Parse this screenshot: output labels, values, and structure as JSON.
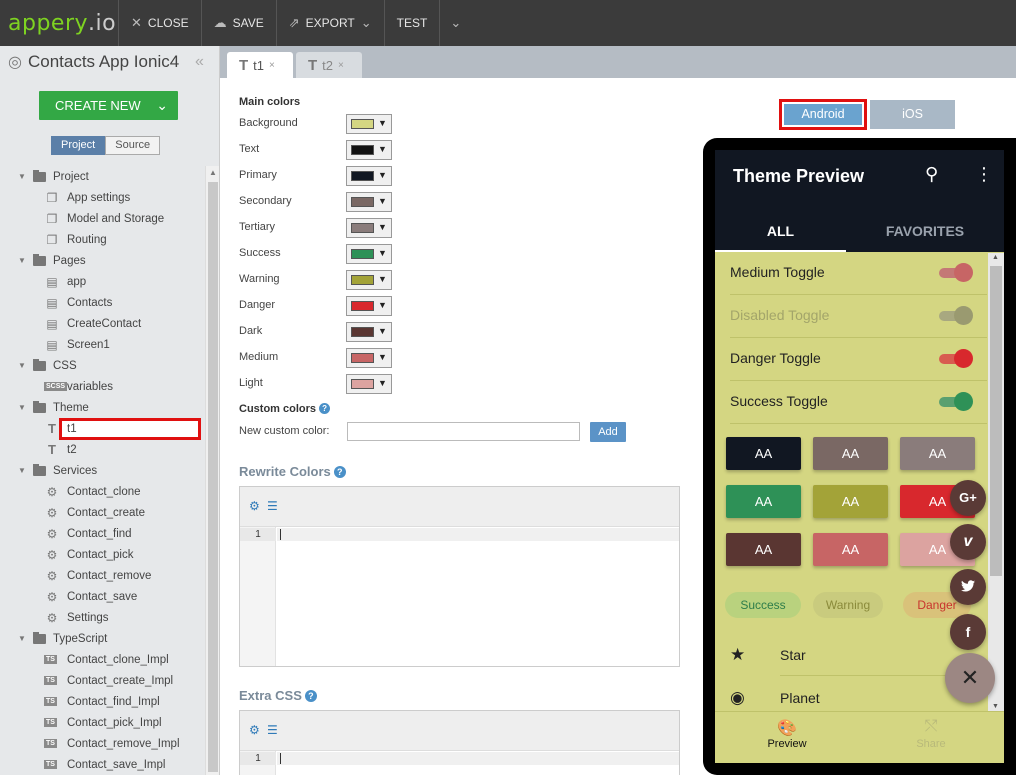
{
  "topbar": {
    "logo_main": "appery",
    "logo_dot": ".io",
    "close_label": "CLOSE",
    "save_label": "SAVE",
    "export_label": "EXPORT",
    "test_label": "TEST"
  },
  "left": {
    "project_title": "Contacts App Ionic4",
    "create_new": "CREATE NEW",
    "tab_project": "Project",
    "tab_source": "Source",
    "tree": [
      {
        "label": "Project",
        "level": 0,
        "icon": "folder"
      },
      {
        "label": "App settings",
        "level": 1,
        "icon": "doc-stack"
      },
      {
        "label": "Model and Storage",
        "level": 1,
        "icon": "doc-stack"
      },
      {
        "label": "Routing",
        "level": 1,
        "icon": "doc-stack"
      },
      {
        "label": "Pages",
        "level": 0,
        "icon": "folder"
      },
      {
        "label": "app",
        "level": 1,
        "icon": "doc"
      },
      {
        "label": "Contacts",
        "level": 1,
        "icon": "doc"
      },
      {
        "label": "CreateContact",
        "level": 1,
        "icon": "doc"
      },
      {
        "label": "Screen1",
        "level": 1,
        "icon": "doc"
      },
      {
        "label": "CSS",
        "level": 0,
        "icon": "folder"
      },
      {
        "label": "variables",
        "level": 1,
        "icon": "scss",
        "badge": "SCSS"
      },
      {
        "label": "Theme",
        "level": 0,
        "icon": "folder"
      },
      {
        "label": "t1",
        "level": 1,
        "icon": "theme"
      },
      {
        "label": "t2",
        "level": 1,
        "icon": "theme"
      },
      {
        "label": "Services",
        "level": 0,
        "icon": "folder"
      },
      {
        "label": "Contact_clone",
        "level": 1,
        "icon": "gear"
      },
      {
        "label": "Contact_create",
        "level": 1,
        "icon": "gear"
      },
      {
        "label": "Contact_find",
        "level": 1,
        "icon": "gear"
      },
      {
        "label": "Contact_pick",
        "level": 1,
        "icon": "gear"
      },
      {
        "label": "Contact_remove",
        "level": 1,
        "icon": "gear"
      },
      {
        "label": "Contact_save",
        "level": 1,
        "icon": "gear"
      },
      {
        "label": "Settings",
        "level": 1,
        "icon": "gear"
      },
      {
        "label": "TypeScript",
        "level": 0,
        "icon": "folder"
      },
      {
        "label": "Contact_clone_Impl",
        "level": 1,
        "icon": "ts",
        "badge": "TS"
      },
      {
        "label": "Contact_create_Impl",
        "level": 1,
        "icon": "ts",
        "badge": "TS"
      },
      {
        "label": "Contact_find_Impl",
        "level": 1,
        "icon": "ts",
        "badge": "TS"
      },
      {
        "label": "Contact_pick_Impl",
        "level": 1,
        "icon": "ts",
        "badge": "TS"
      },
      {
        "label": "Contact_remove_Impl",
        "level": 1,
        "icon": "ts",
        "badge": "TS"
      },
      {
        "label": "Contact_save_Impl",
        "level": 1,
        "icon": "ts",
        "badge": "TS"
      }
    ]
  },
  "tabs": [
    {
      "label": "t1",
      "glyph": "T",
      "close": "×"
    },
    {
      "label": "t2",
      "glyph": "T",
      "close": "×"
    }
  ],
  "form": {
    "main_colors_title": "Main colors",
    "colors": [
      {
        "label": "Background",
        "color": "#d4d682"
      },
      {
        "label": "Text",
        "color": "#111111"
      },
      {
        "label": "Primary",
        "color": "#111722"
      },
      {
        "label": "Secondary",
        "color": "#7a6864"
      },
      {
        "label": "Tertiary",
        "color": "#8a7c7b"
      },
      {
        "label": "Success",
        "color": "#2e9157"
      },
      {
        "label": "Warning",
        "color": "#a3a338"
      },
      {
        "label": "Danger",
        "color": "#d8282d"
      },
      {
        "label": "Dark",
        "color": "#5a3632"
      },
      {
        "label": "Medium",
        "color": "#c76565"
      },
      {
        "label": "Light",
        "color": "#dca3a0"
      }
    ],
    "custom_colors_title": "Custom colors",
    "new_custom_label": "New custom color:",
    "new_custom_value": "",
    "add_label": "Add",
    "rewrite_title": "Rewrite Colors",
    "extra_css_title": "Extra CSS",
    "line_1": "1"
  },
  "preview": {
    "android_label": "Android",
    "ios_label": "iOS",
    "app_title": "Theme Preview",
    "seg_all": "ALL",
    "seg_favorites": "FAVORITES",
    "toggles": [
      {
        "label": "Medium Toggle",
        "track": "#c47876",
        "knob": "#c76565",
        "label_color": "#222"
      },
      {
        "label": "Disabled Toggle",
        "track": "#a8a880",
        "knob": "#9a9a70",
        "label_color": "#a3a56a"
      },
      {
        "label": "Danger Toggle",
        "track": "#d85c50",
        "knob": "#d8282d",
        "label_color": "#222"
      },
      {
        "label": "Success Toggle",
        "track": "#5aa070",
        "knob": "#2e9157",
        "label_color": "#222"
      }
    ],
    "aa_buttons": [
      {
        "label": "AA",
        "color": "#111722"
      },
      {
        "label": "AA",
        "color": "#7a6864"
      },
      {
        "label": "AA",
        "color": "#8a7c7b"
      },
      {
        "label": "AA",
        "color": "#2e9157"
      },
      {
        "label": "AA",
        "color": "#a3a338"
      },
      {
        "label": "AA",
        "color": "#d8282d"
      },
      {
        "label": "AA",
        "color": "#5a3632"
      },
      {
        "label": "AA",
        "color": "#c76565"
      },
      {
        "label": "AA",
        "color": "#dca3a0"
      }
    ],
    "chips": [
      {
        "label": "Success",
        "bg": "#b9d27e",
        "fg": "#2e7d4a"
      },
      {
        "label": "Warning",
        "bg": "#c9cb7e",
        "fg": "#8a8a3a"
      },
      {
        "label": "Danger",
        "bg": "#d9c27a",
        "fg": "#c8342d"
      }
    ],
    "list": [
      {
        "label": "Star",
        "icon": "star-icon"
      },
      {
        "label": "Planet",
        "icon": "planet-icon"
      }
    ],
    "fabs": [
      "G+",
      "v",
      "twitter",
      "f"
    ],
    "bottom_preview": "Preview",
    "bottom_share": "Share"
  }
}
